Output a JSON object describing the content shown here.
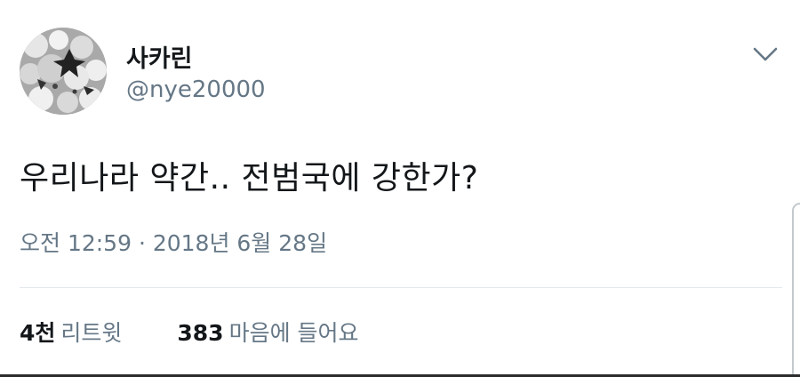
{
  "tweet": {
    "author": {
      "display_name": "사카린",
      "handle": "@nye20000",
      "avatar_icon": "avatar-image"
    },
    "menu_icon": "chevron-down-icon",
    "text": "우리나라 약간.. 전범국에 강한가?",
    "timestamp": "오전 12:59 · 2018년 6월 28일",
    "stats": {
      "retweets_count": "4천",
      "retweets_label": "리트윗",
      "likes_count": "383",
      "likes_label": "마음에 들어요"
    }
  },
  "colors": {
    "primary_text": "#14171a",
    "secondary_text": "#657786",
    "divider": "#e1e8ed",
    "background": "#ffffff"
  }
}
